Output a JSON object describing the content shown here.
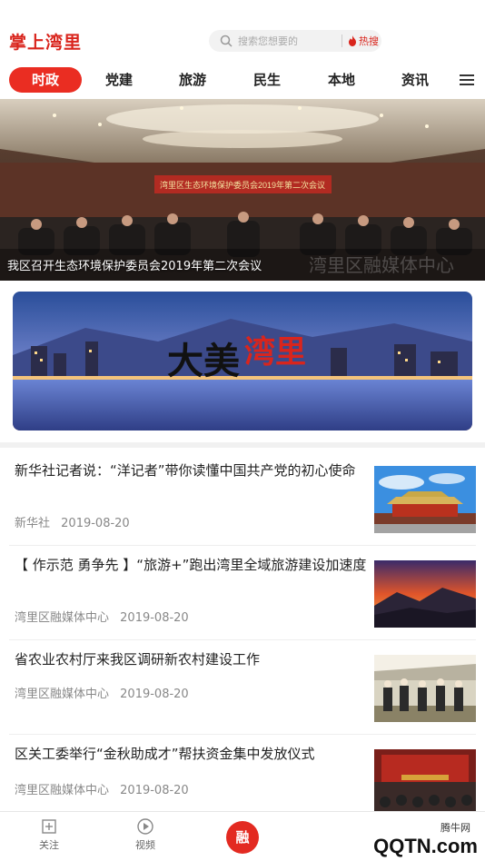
{
  "header": {
    "logo_text": "掌上湾里",
    "search_placeholder": "搜索您想要的",
    "hot_search_label": "热搜"
  },
  "tabs": [
    {
      "label": "时政",
      "active": true
    },
    {
      "label": "党建"
    },
    {
      "label": "旅游"
    },
    {
      "label": "民生"
    },
    {
      "label": "本地"
    },
    {
      "label": "资讯"
    }
  ],
  "hero": {
    "caption": "我区召开生态环境保护委员会2019年第二次会议",
    "banner_text": "湾里区生态环境保护委员会2019年第二次会议",
    "overlay_text": "湾里区融媒体中心"
  },
  "banner": {
    "title_black": "大美",
    "title_red": "湾里"
  },
  "news": [
    {
      "title": "新华社记者说：“洋记者”带你读懂中国共产党的初心使命",
      "source": "新华社",
      "date": "2019-08-20"
    },
    {
      "title": "【 作示范 勇争先 】“旅游+”跑出湾里全域旅游建设加速度",
      "source": "湾里区融媒体中心",
      "date": "2019-08-20"
    },
    {
      "title": "省农业农村厅来我区调研新农村建设工作",
      "source": "湾里区融媒体中心",
      "date": "2019-08-20"
    },
    {
      "title": "区关工委举行“金秋助成才”帮扶资金集中发放仪式",
      "source": "湾里区融媒体中心",
      "date": "2019-08-20"
    }
  ],
  "bottom_nav": {
    "follow": "关注",
    "video": "视频",
    "center": "融",
    "watermark_text": "QQTN.com",
    "watermark_small": "腾牛网"
  },
  "colors": {
    "brand": "#d9251d",
    "active_tab": "#ea2d22"
  }
}
